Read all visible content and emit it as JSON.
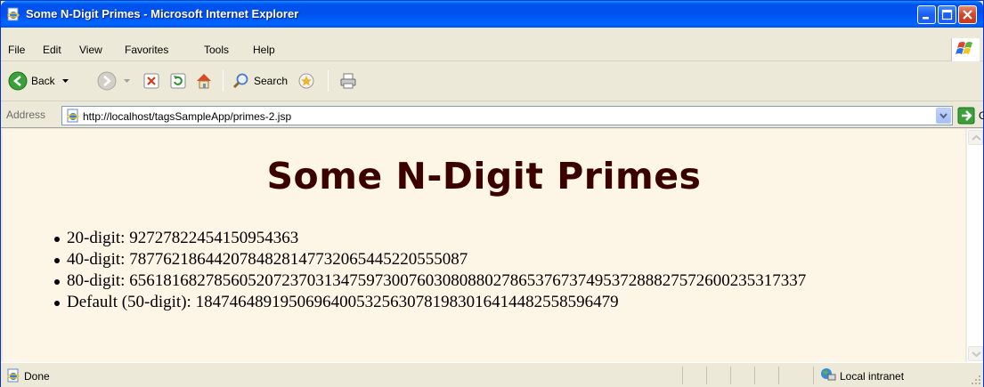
{
  "window": {
    "title": "Some N-Digit Primes - Microsoft Internet Explorer"
  },
  "menu": {
    "items": [
      "File",
      "Edit",
      "View",
      "Favorites",
      "Tools",
      "Help"
    ]
  },
  "toolbar": {
    "back_label": "Back",
    "search_label": "Search"
  },
  "address": {
    "label": "Address",
    "url": "http://localhost/tagsSampleApp/primes-2.jsp",
    "go_label": "Go"
  },
  "page": {
    "heading": "Some N-Digit Primes",
    "items": [
      "20-digit: 92727822454150954363",
      "40-digit: 7877621864420784828147732065445220555087",
      "80-digit: 65618168278560520723703134759730076030808802786537673749537288827572600235317337",
      "Default (50-digit): 18474648919506964005325630781983016414482558596479"
    ]
  },
  "status": {
    "text": "Done",
    "zone": "Local intranet"
  },
  "colors": {
    "heading": "#3b0000",
    "content_bg": "#fdf5e6",
    "titlebar": "#0053ee"
  }
}
